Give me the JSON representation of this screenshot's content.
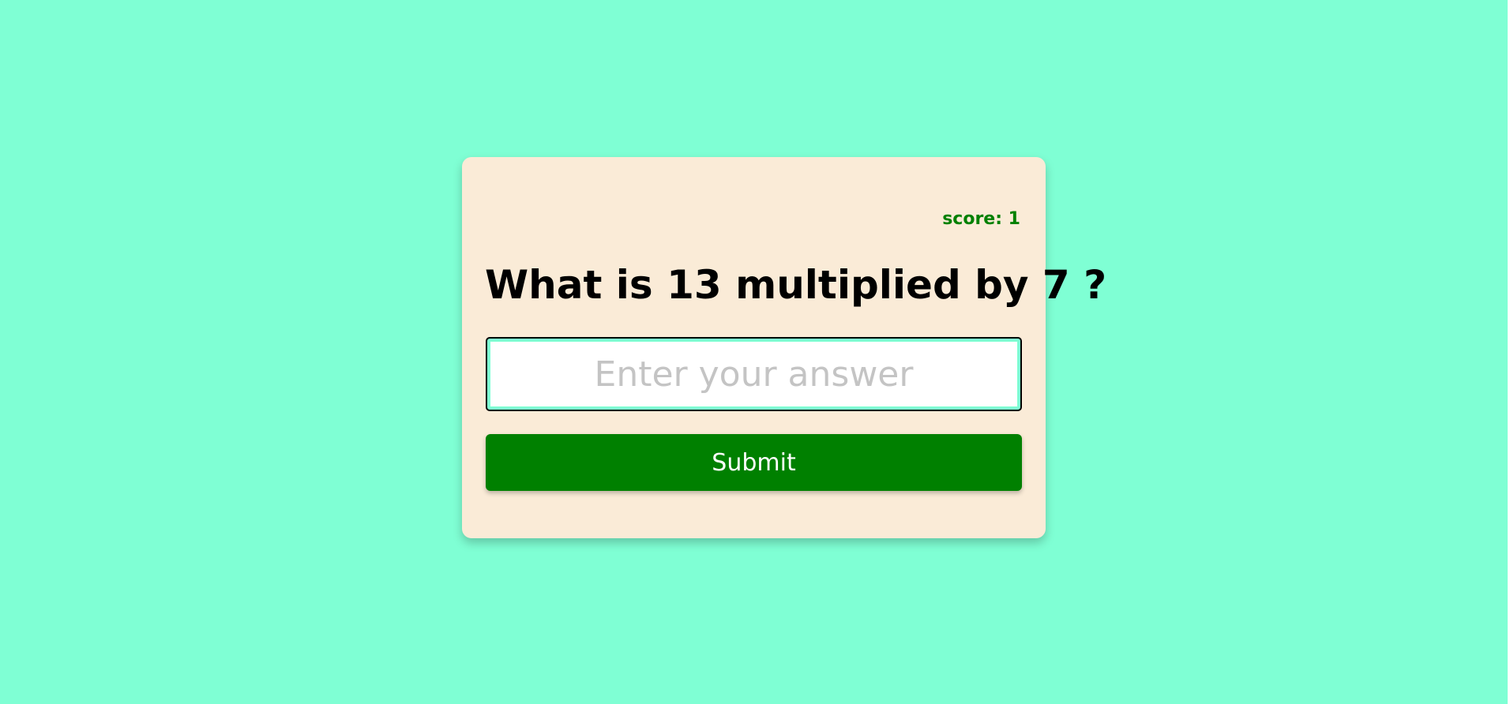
{
  "colors": {
    "page_background": "#7fffd4",
    "card_background": "#faebd7",
    "accent_green": "#008000",
    "placeholder_gray": "#c4c4c4"
  },
  "quiz": {
    "score_text": "score: 1",
    "question_text": "What is 13 multiplied by 7 ?",
    "answer_placeholder": "Enter your answer",
    "answer_value": "",
    "submit_label": "Submit"
  }
}
